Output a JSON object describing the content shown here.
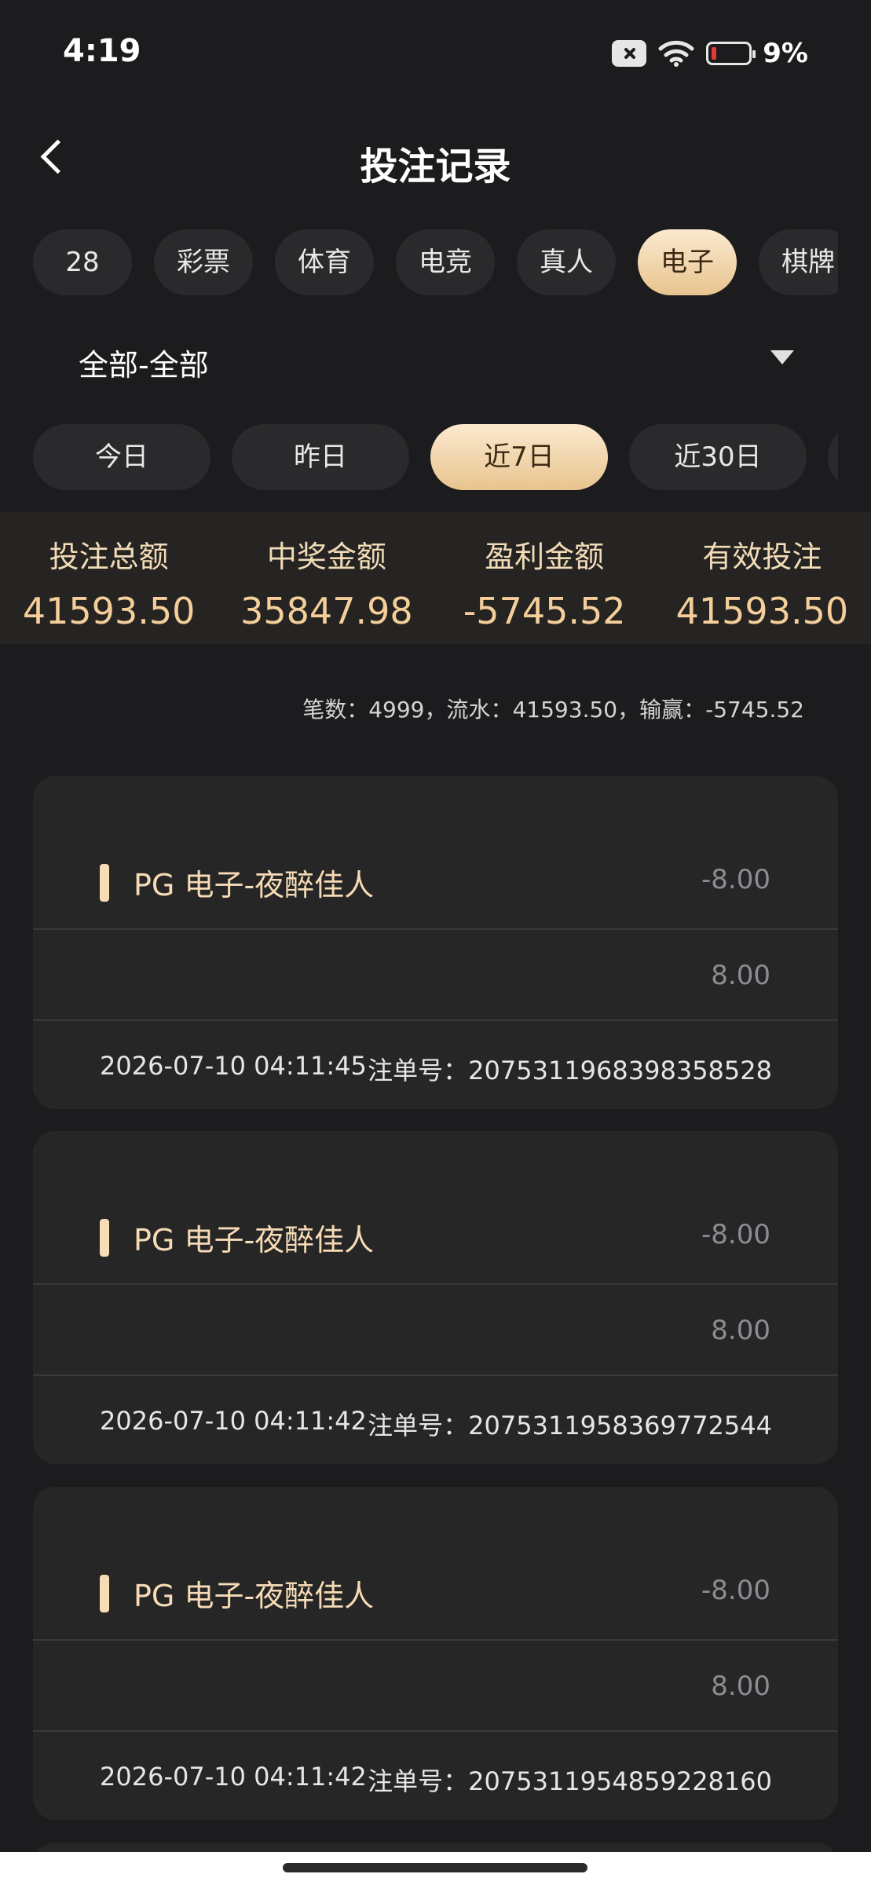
{
  "status_bar": {
    "time": "4:19",
    "battery_pct": "9%"
  },
  "header": {
    "title": "投注记录"
  },
  "category_tabs": [
    {
      "label": "28"
    },
    {
      "label": "彩票"
    },
    {
      "label": "体育"
    },
    {
      "label": "电竞"
    },
    {
      "label": "真人"
    },
    {
      "label": "电子",
      "active": true
    },
    {
      "label": "棋牌"
    }
  ],
  "dropdown": {
    "value": "全部-全部"
  },
  "date_tabs": [
    {
      "label": "今日"
    },
    {
      "label": "昨日"
    },
    {
      "label": "近7日",
      "active": true
    },
    {
      "label": "近30日"
    },
    {
      "label": ""
    }
  ],
  "summary": [
    {
      "label": "投注总额",
      "value": "41593.50"
    },
    {
      "label": "中奖金额",
      "value": "35847.98"
    },
    {
      "label": "盈利金额",
      "value": "-5745.52"
    },
    {
      "label": "有效投注",
      "value": "41593.50"
    }
  ],
  "totals_line": "笔数：4999，流水：41593.50，输赢：-5745.52",
  "bets": [
    {
      "game": "PG 电子-夜醉佳人",
      "win_loss": "-8.00",
      "bet_amount": "8.00",
      "time": "2026-07-10 04:11:45",
      "order": "注单号：2075311968398358528"
    },
    {
      "game": "PG 电子-夜醉佳人",
      "win_loss": "-8.00",
      "bet_amount": "8.00",
      "time": "2026-07-10 04:11:42",
      "order": "注单号：2075311958369772544"
    },
    {
      "game": "PG 电子-夜醉佳人",
      "win_loss": "-8.00",
      "bet_amount": "8.00",
      "time": "2026-07-10 04:11:42",
      "order": "注单号：2075311954859228160"
    }
  ],
  "colors": {
    "background": "#1c1c1e",
    "accent_gold": "#f4cf9a",
    "active_tab_gradient_top": "#fbe9cf",
    "active_tab_gradient_bottom": "#e8c48f",
    "card_bg": "#262626"
  }
}
